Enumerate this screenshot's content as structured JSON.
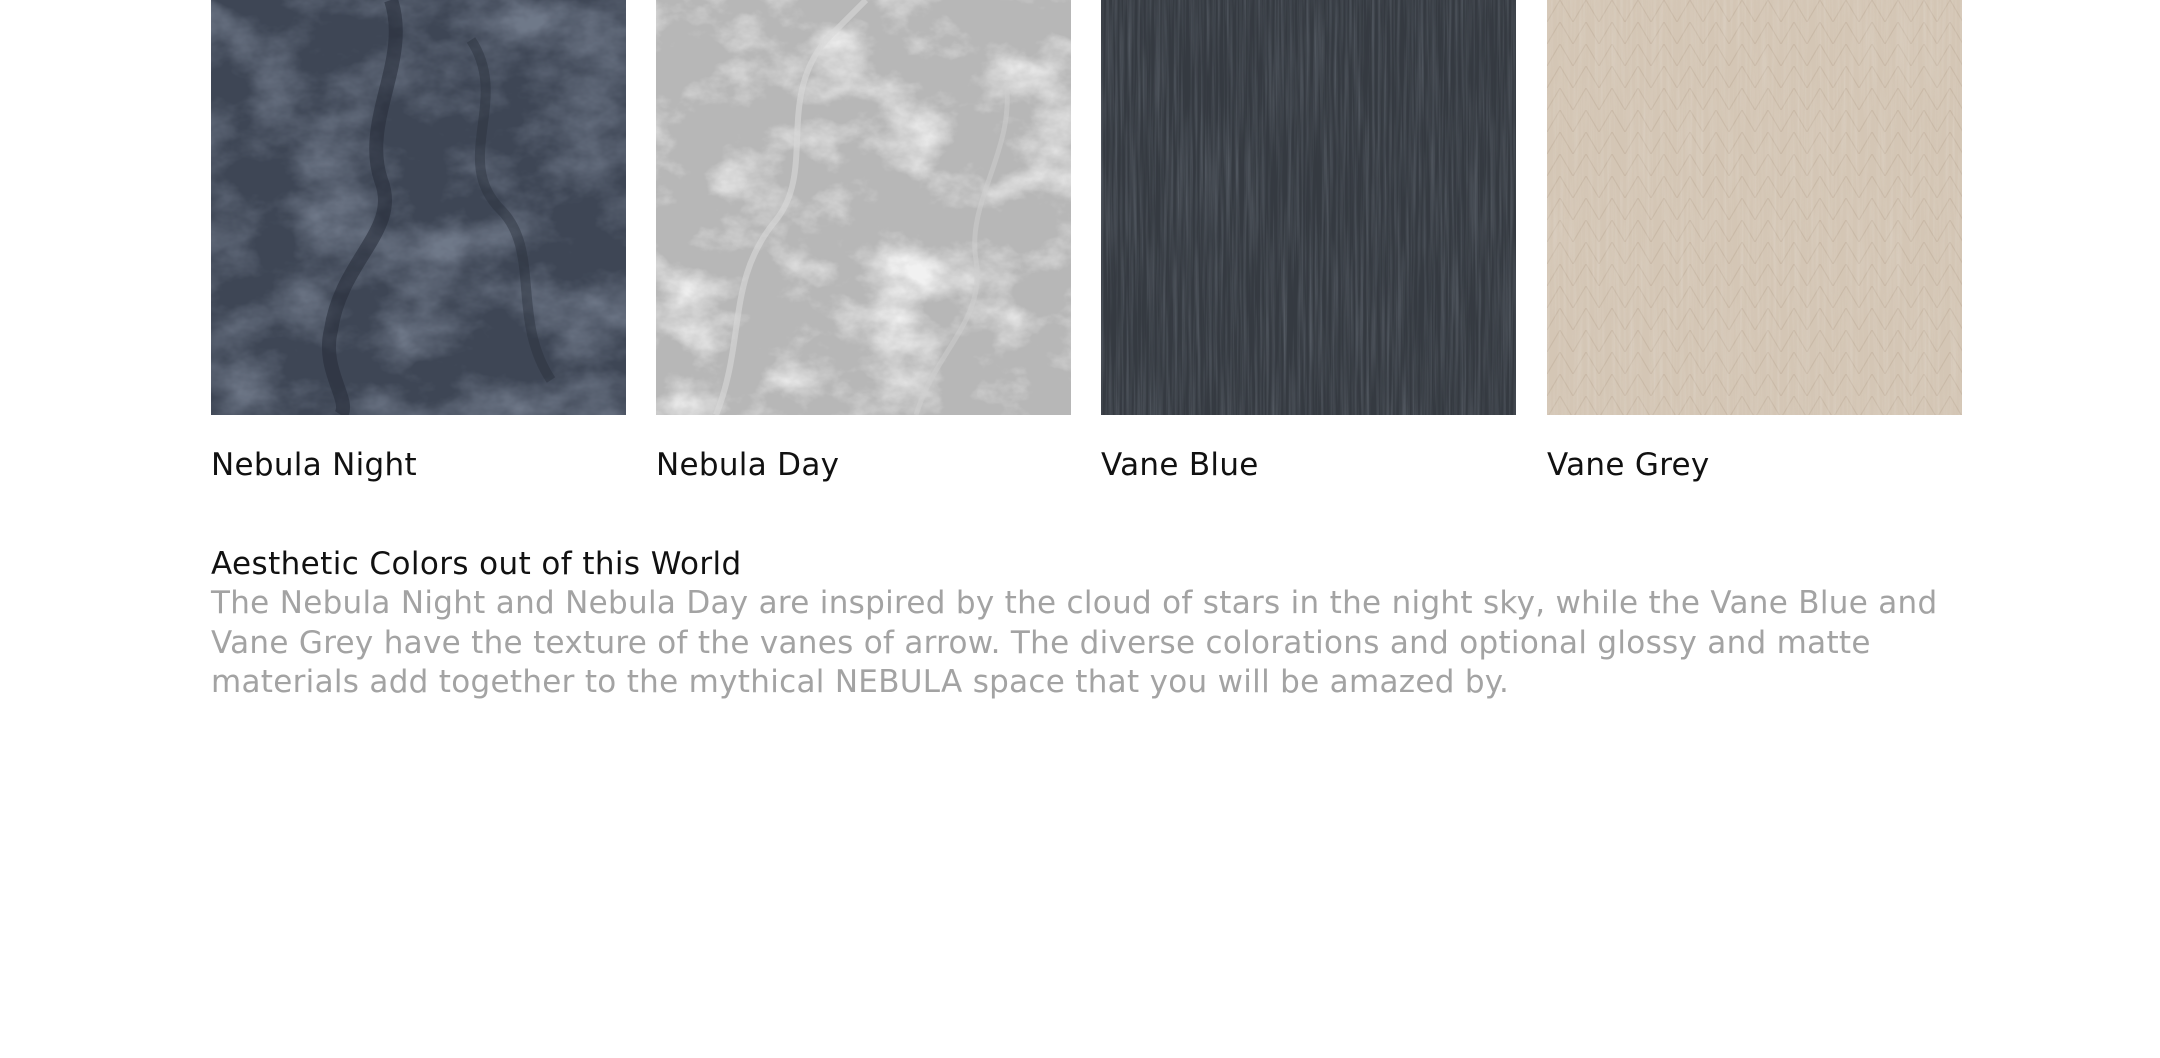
{
  "swatches": [
    {
      "name": "Nebula Night",
      "icon": "nebula-night-texture",
      "base_color": "#3e4655"
    },
    {
      "name": "Nebula Day",
      "icon": "nebula-day-texture",
      "base_color": "#b9b9b9"
    },
    {
      "name": "Vane Blue",
      "icon": "vane-blue-texture",
      "base_color": "#34393f"
    },
    {
      "name": "Vane Grey",
      "icon": "vane-grey-texture",
      "base_color": "#d3c5b4"
    }
  ],
  "description": {
    "title": "Aesthetic Colors out of this World",
    "body": "The Nebula Night and Nebula Day are inspired by the cloud of stars in the night sky, while the Vane Blue and Vane Grey have the texture of the vanes of arrow. The diverse colorations and optional glossy and matte materials add together to the mythical NEBULA space that you will be amazed by."
  }
}
